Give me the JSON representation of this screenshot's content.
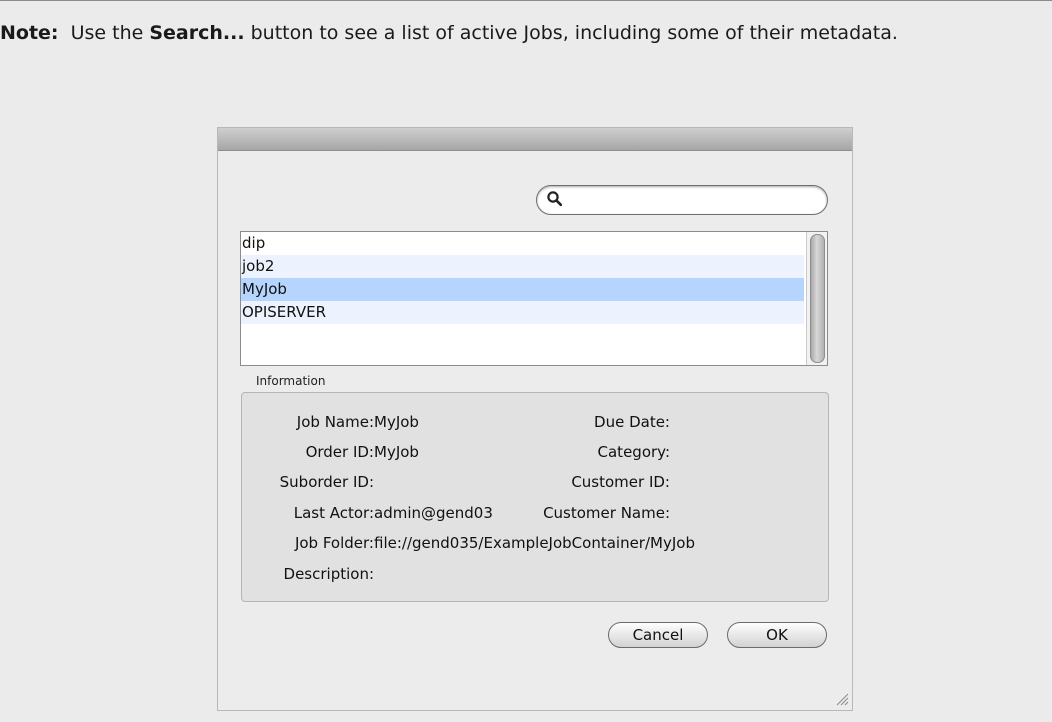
{
  "note": {
    "label": "Note:",
    "text_before": "Use the",
    "button_ref": "Search...",
    "text_after": "button to see a list of active Jobs, including some of their metadata."
  },
  "dialog": {
    "search": {
      "placeholder": "",
      "value": ""
    },
    "jobs": [
      {
        "name": "dip",
        "state": "normal"
      },
      {
        "name": "job2",
        "state": "alt"
      },
      {
        "name": "MyJob",
        "state": "selected"
      },
      {
        "name": "OPISERVER",
        "state": "alt"
      }
    ],
    "info": {
      "legend": "Information",
      "job_name_label": "Job Name:",
      "job_name_value": "MyJob",
      "order_id_label": "Order ID:",
      "order_id_value": "MyJob",
      "suborder_id_label": "Suborder ID:",
      "suborder_id_value": "",
      "last_actor_label": "Last Actor:",
      "last_actor_value": "admin@gend03",
      "job_folder_label": "Job Folder:",
      "job_folder_value": "file://gend035/ExampleJobContainer/MyJob",
      "description_label": "Description:",
      "description_value": "",
      "due_date_label": "Due Date:",
      "due_date_value": "",
      "category_label": "Category:",
      "category_value": "",
      "customer_id_label": "Customer ID:",
      "customer_id_value": "",
      "customer_name_label": "Customer Name:",
      "customer_name_value": ""
    },
    "buttons": {
      "cancel": "Cancel",
      "ok": "OK"
    }
  },
  "colors": {
    "selection": "#b5d5ff",
    "alt_row": "#edf3fe",
    "panel": "#e1e1e1"
  }
}
